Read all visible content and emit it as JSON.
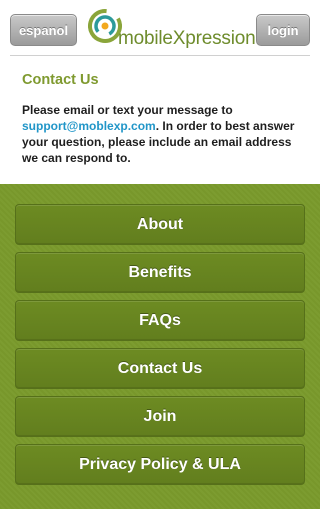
{
  "header": {
    "language_button": "espanol",
    "login_button": "login",
    "logo_text": "mobileXpression",
    "brand_color": "#7f9a2f"
  },
  "content": {
    "title": "Contact Us",
    "text_before_link": "Please email or text your message to ",
    "email": "support@moblexp.com",
    "text_after_link": ". In order to best answer your question, please include an email address we can respond to."
  },
  "menu": {
    "items": [
      {
        "label": "About"
      },
      {
        "label": "Benefits"
      },
      {
        "label": "FAQs"
      },
      {
        "label": "Contact Us"
      },
      {
        "label": "Join"
      },
      {
        "label": "Privacy Policy & ULA"
      }
    ],
    "background_color": "#7a9a2c"
  }
}
